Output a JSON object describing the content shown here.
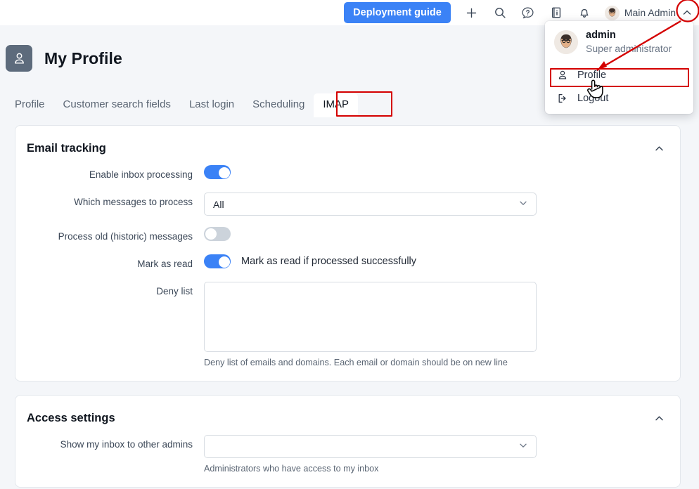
{
  "topbar": {
    "deploy_button": "Deployment guide",
    "icons": [
      "plus-icon",
      "search-icon",
      "help-icon",
      "info-icon",
      "bell-icon"
    ],
    "user_name": "Main Admin",
    "caret": "chevron-up-icon"
  },
  "page": {
    "title": "My Profile",
    "icon": "user-icon"
  },
  "tabs": [
    {
      "label": "Profile",
      "active": false
    },
    {
      "label": "Customer search fields",
      "active": false
    },
    {
      "label": "Last login",
      "active": false
    },
    {
      "label": "Scheduling",
      "active": false
    },
    {
      "label": "IMAP",
      "active": true
    }
  ],
  "cards": [
    {
      "title": "Email tracking",
      "collapse_icon": "chevron-up-icon",
      "rows": [
        {
          "label": "Enable inbox processing",
          "type": "toggle",
          "value": "on",
          "text": ""
        },
        {
          "label": "Which messages to process",
          "type": "select",
          "value": "All",
          "hint": ""
        },
        {
          "label": "Process old (historic) messages",
          "type": "toggle",
          "value": "off",
          "text": ""
        },
        {
          "label": "Mark as read",
          "type": "toggle",
          "value": "on",
          "text": "Mark as read if processed successfully"
        },
        {
          "label": "Deny list",
          "type": "textarea",
          "value": "",
          "hint": "Deny list of emails and domains. Each email or domain should be on new line"
        }
      ]
    },
    {
      "title": "Access settings",
      "collapse_icon": "chevron-up-icon",
      "rows": [
        {
          "label": "Show my inbox to other admins",
          "type": "select",
          "value": "",
          "hint": "Administrators who have access to my inbox"
        }
      ]
    }
  ],
  "user_menu": {
    "name": "admin",
    "role": "Super administrator",
    "items": [
      {
        "label": "Profile",
        "icon": "user-icon",
        "highlighted": true
      },
      {
        "label": "Logout",
        "icon": "logout-icon",
        "highlighted": false
      }
    ]
  },
  "colors": {
    "accent_blue": "#3b82f6",
    "annotation_red": "#d40000",
    "page_background": "#f4f6f9",
    "card_background": "#ffffff",
    "toggle_off": "#ccd3db",
    "page_icon_background": "#5d6b7c"
  }
}
